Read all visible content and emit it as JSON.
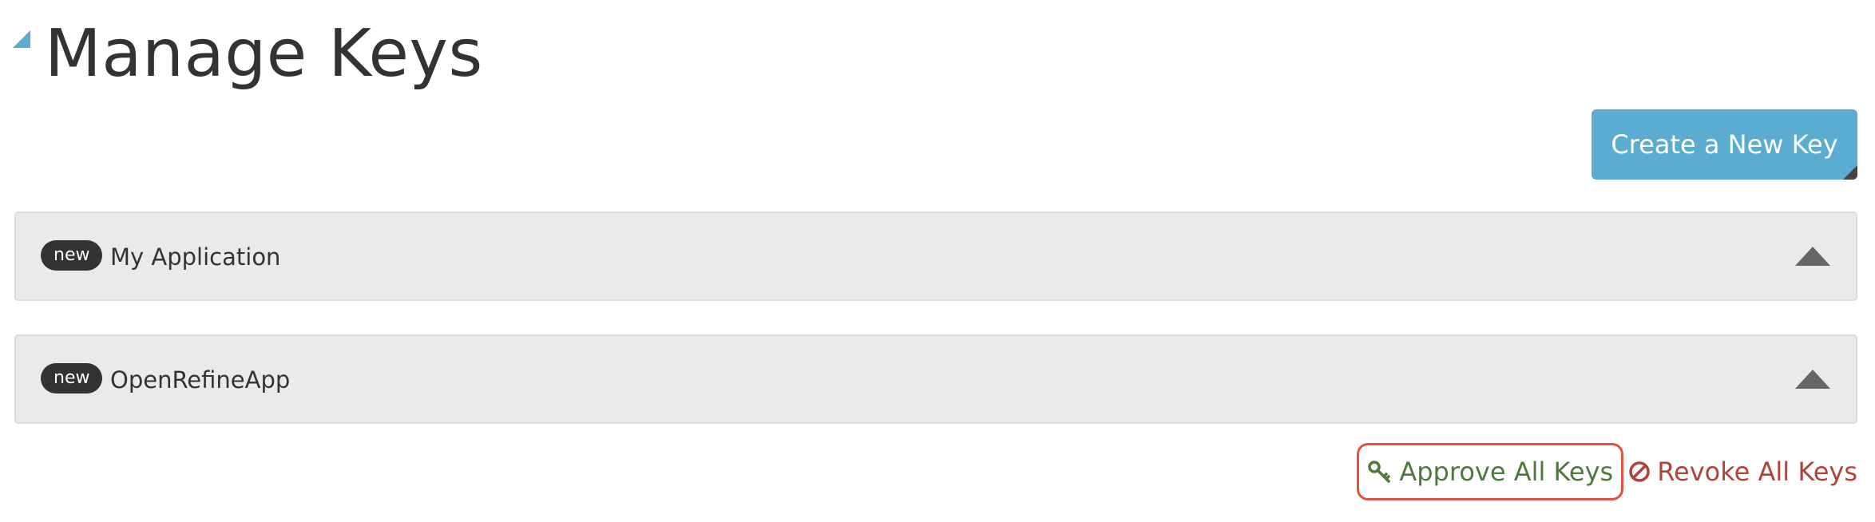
{
  "page": {
    "title": "Manage Keys"
  },
  "toolbar": {
    "create_label": "Create a New Key"
  },
  "keys": [
    {
      "badge": "new",
      "name": "My Application"
    },
    {
      "badge": "new",
      "name": "OpenRefineApp"
    }
  ],
  "actions": {
    "approve_label": "Approve All Keys",
    "approve_icon": "key-icon",
    "revoke_label": "Revoke All Keys",
    "revoke_icon": "ban-icon"
  },
  "colors": {
    "accent": "#5aadd0",
    "approve": "#4c7a3a",
    "revoke": "#b0433a",
    "highlight": "#e0513e",
    "panel": "#eaeaea"
  }
}
